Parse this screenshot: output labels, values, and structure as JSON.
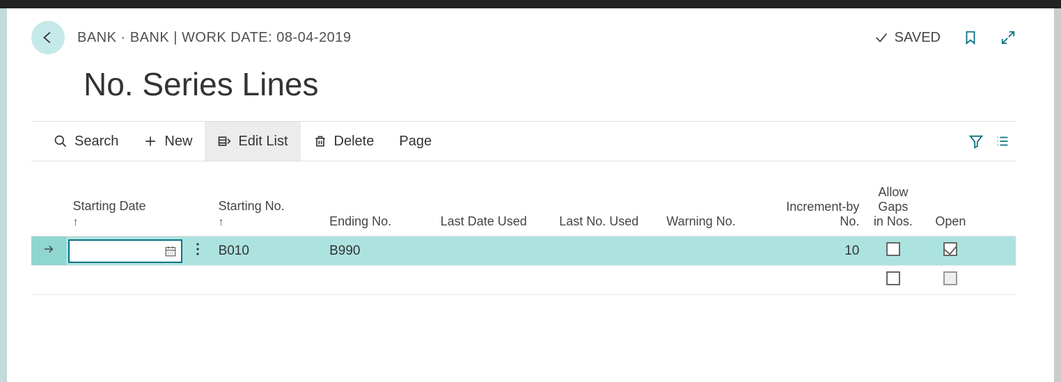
{
  "header": {
    "breadcrumb": "BANK · BANK | WORK DATE: 08-04-2019",
    "saved_label": "SAVED",
    "page_title": "No. Series Lines"
  },
  "toolbar": {
    "search": "Search",
    "new": "New",
    "edit_list": "Edit List",
    "delete": "Delete",
    "page": "Page"
  },
  "grid": {
    "columns": [
      "Starting Date",
      "Starting No.",
      "Ending No.",
      "Last Date Used",
      "Last No. Used",
      "Warning No.",
      "Increment-by No.",
      "Allow Gaps in Nos.",
      "Open"
    ],
    "rows": [
      {
        "starting_date": "",
        "starting_no": "B010",
        "ending_no": "B990",
        "last_date_used": "",
        "last_no_used": "",
        "warning_no": "",
        "increment_by": "10",
        "allow_gaps": false,
        "open": true
      },
      {
        "starting_date": "",
        "starting_no": "",
        "ending_no": "",
        "last_date_used": "",
        "last_no_used": "",
        "warning_no": "",
        "increment_by": "",
        "allow_gaps": false,
        "open": false
      }
    ]
  },
  "colors": {
    "accent": "#0b7285",
    "selection": "#ace3df",
    "back_button": "#c5e9e8"
  }
}
